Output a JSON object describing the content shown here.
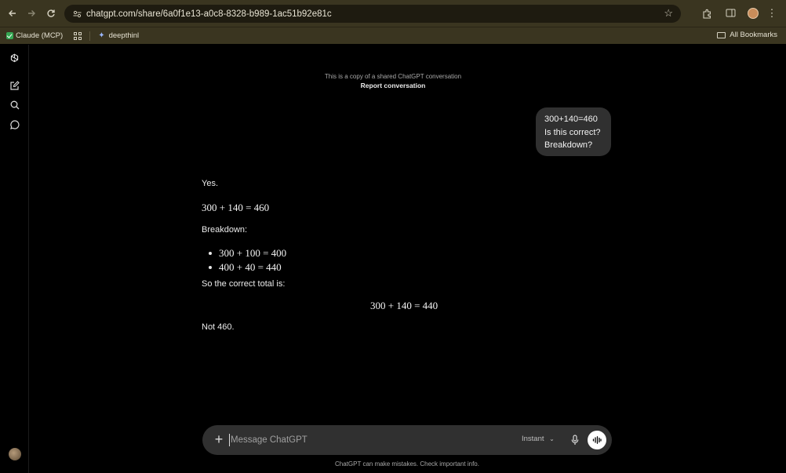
{
  "browser": {
    "url": "chatgpt.com/share/6a0f1e13-a0c8-8328-b989-1ac51b92e81c",
    "bookmarks": [
      {
        "label": "Claude (MCP)"
      },
      {
        "label": "deepthinl"
      }
    ],
    "all_bookmarks_label": "All Bookmarks"
  },
  "banner": {
    "note": "This is a copy of a shared ChatGPT conversation",
    "report_link": "Report conversation"
  },
  "conversation": {
    "user_message_lines": [
      "300+140=460",
      "Is this correct?",
      "Breakdown?"
    ],
    "assistant": {
      "yes": "Yes.",
      "equation1": "300 + 140 = 460",
      "breakdown_label": "Breakdown:",
      "bullets": [
        "300 + 100 = 400",
        "400 + 40 = 440"
      ],
      "total_label": "So the correct total is:",
      "equation_centered": "300 + 140 = 440",
      "closing": "Not 460."
    }
  },
  "composer": {
    "placeholder": "Message ChatGPT",
    "model_label": "Instant"
  },
  "disclaimer": "ChatGPT can make mistakes. Check important info.",
  "colors": {
    "browser_chrome": "#3a3520",
    "omnibox": "#1e1b10",
    "background": "#000000",
    "bubble": "#303030",
    "composer": "#303030"
  }
}
